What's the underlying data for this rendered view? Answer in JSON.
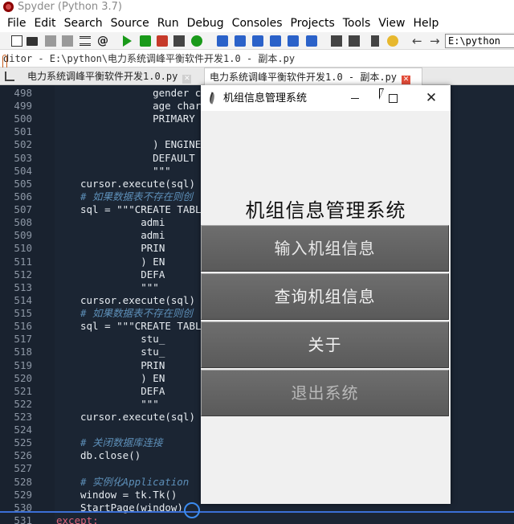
{
  "app": {
    "title": "Spyder (Python 3.7)"
  },
  "menu": [
    "File",
    "Edit",
    "Search",
    "Source",
    "Run",
    "Debug",
    "Consoles",
    "Projects",
    "Tools",
    "View",
    "Help"
  ],
  "toolbar": {
    "icons": [
      "new-file-icon",
      "open-folder-icon",
      "save-icon",
      "save-all-icon",
      "list-icon",
      "at-icon",
      "run-icon",
      "run-cell-icon",
      "run-cell-advance-icon",
      "run-selection-icon",
      "rerun-icon",
      "debug-icon",
      "step-icon",
      "step-into-icon",
      "step-return-icon",
      "continue-icon",
      "stop-icon",
      "maximize-pane-icon",
      "fullscreen-icon",
      "wrench-icon",
      "python-icon",
      "back-icon",
      "forward-icon"
    ],
    "path_value": "E:\\python"
  },
  "editor": {
    "path": "ditor - E:\\python\\电力系统调峰平衡软件开发1.0 - 副本.py",
    "tabs": [
      {
        "label": "电力系统调峰平衡软件开发1.0.py"
      },
      {
        "label": "电力系统调峰平衡软件开发1.0 - 副本.py"
      }
    ],
    "lines": [
      {
        "n": "498",
        "indent": 8,
        "text": "    gender char(",
        "kind": "tx"
      },
      {
        "n": "499",
        "indent": 8,
        "text": "    age char(60)",
        "kind": "tx"
      },
      {
        "n": "500",
        "indent": 8,
        "text": "    PRIMARY KEY",
        "kind": "tx"
      },
      {
        "n": "501",
        "indent": 0,
        "text": "",
        "kind": "tx"
      },
      {
        "n": "502",
        "indent": 8,
        "text": "    ) ENGINE = I",
        "kind": "tx"
      },
      {
        "n": "503",
        "indent": 8,
        "text": "    DEFAULT CHAR",
        "kind": "tx"
      },
      {
        "n": "504",
        "indent": 8,
        "text": "    \"\"\"",
        "kind": "tx"
      },
      {
        "n": "505",
        "indent": 0,
        "text": "cursor.execute(sql)",
        "kind": "tx"
      },
      {
        "n": "506",
        "indent": 0,
        "text": "# 如果数据表不存在则创",
        "kind": "cm"
      },
      {
        "n": "507",
        "indent": 0,
        "text": "sql = \"\"\"CREATE TABL",
        "kind": "tx"
      },
      {
        "n": "508",
        "indent": 0,
        "text": "          admi",
        "kind": "tx"
      },
      {
        "n": "509",
        "indent": 0,
        "text": "          admi",
        "kind": "tx"
      },
      {
        "n": "510",
        "indent": 0,
        "text": "          PRIN",
        "kind": "tx"
      },
      {
        "n": "511",
        "indent": 0,
        "text": "          ) EN",
        "kind": "tx"
      },
      {
        "n": "512",
        "indent": 0,
        "text": "          DEFA",
        "kind": "tx"
      },
      {
        "n": "513",
        "indent": 0,
        "text": "          \"\"\"",
        "kind": "tx"
      },
      {
        "n": "514",
        "indent": 0,
        "text": "cursor.execute(sql)",
        "kind": "tx"
      },
      {
        "n": "515",
        "indent": 0,
        "text": "# 如果数据表不存在则创",
        "kind": "cm"
      },
      {
        "n": "516",
        "indent": 0,
        "text": "sql = \"\"\"CREATE TABL",
        "kind": "tx"
      },
      {
        "n": "517",
        "indent": 0,
        "text": "          stu_",
        "kind": "tx"
      },
      {
        "n": "518",
        "indent": 0,
        "text": "          stu_",
        "kind": "tx"
      },
      {
        "n": "519",
        "indent": 0,
        "text": "          PRIN",
        "kind": "tx"
      },
      {
        "n": "520",
        "indent": 0,
        "text": "          ) EN",
        "kind": "tx"
      },
      {
        "n": "521",
        "indent": 0,
        "text": "          DEFA",
        "kind": "tx"
      },
      {
        "n": "522",
        "indent": 0,
        "text": "          \"\"\"",
        "kind": "tx"
      },
      {
        "n": "523",
        "indent": 0,
        "text": "cursor.execute(sql)",
        "kind": "tx"
      },
      {
        "n": "524",
        "indent": 0,
        "text": "",
        "kind": "tx"
      },
      {
        "n": "525",
        "indent": 0,
        "text": "# 关闭数据库连接",
        "kind": "cm"
      },
      {
        "n": "526",
        "indent": 0,
        "text": "db.close()",
        "kind": "tx"
      },
      {
        "n": "527",
        "indent": 0,
        "text": "",
        "kind": "tx"
      },
      {
        "n": "528",
        "indent": 0,
        "text": "# 实例化Application",
        "kind": "cm"
      },
      {
        "n": "529",
        "indent": 0,
        "text": "window = tk.Tk()",
        "kind": "tx"
      },
      {
        "n": "530",
        "indent": 0,
        "text": "StartPage(window)",
        "kind": "tx"
      },
      {
        "n": "531",
        "indent": -8,
        "text": "except:",
        "kind": "kw"
      }
    ]
  },
  "dialog": {
    "title": "机组信息管理系统",
    "banner": "机组信息管理系统",
    "buttons": [
      "输入机组信息",
      "查询机组信息",
      "关于",
      "退出系统"
    ]
  },
  "colors": {
    "editor_bg": "#1b2533",
    "accent_blue": "#3b6fd6",
    "button_gray": "#636363",
    "keyword_red": "#e0637a",
    "comment_blue": "#5d8fb8"
  }
}
